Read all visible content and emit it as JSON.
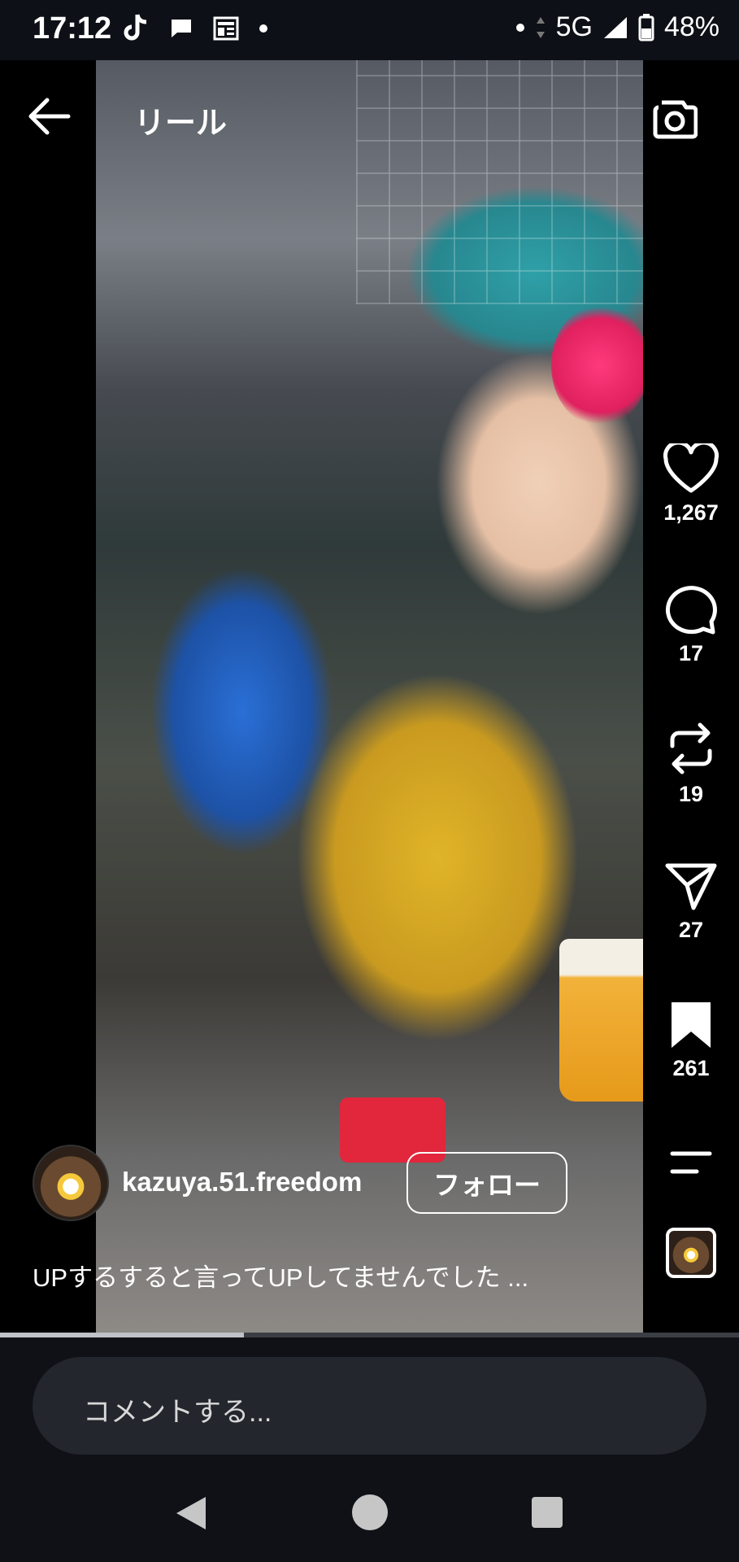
{
  "status_bar": {
    "time": "17:12",
    "network": "5G",
    "battery": "48%",
    "icons": [
      "tiktok-icon",
      "message-icon",
      "news-icon",
      "dot-icon"
    ]
  },
  "header": {
    "title": "リール",
    "back_icon": "arrow-left-icon",
    "camera_icon": "camera-icon"
  },
  "actions": {
    "likes": "1,267",
    "comments": "17",
    "reposts": "19",
    "shares": "27",
    "saves": "261"
  },
  "post": {
    "username": "kazuya.51.freedom",
    "follow_label": "フォロー",
    "caption": "UPするすると言ってUPしてませんでした ..."
  },
  "video": {
    "progress": 0.33
  },
  "comment": {
    "placeholder": "コメントする..."
  },
  "colors": {
    "background": "#0f1117",
    "comment_box": "#23262d",
    "text": "#ffffff"
  }
}
